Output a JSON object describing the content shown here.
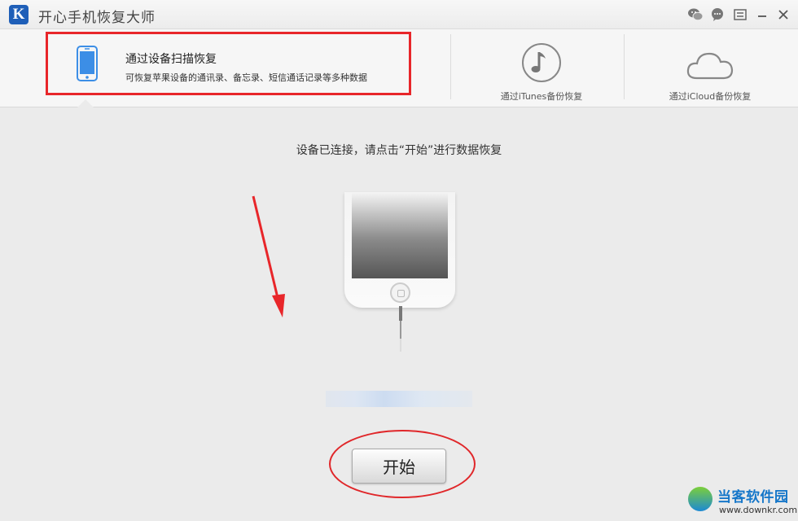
{
  "window": {
    "logo_letter": "K",
    "title": "开心手机恢复大师",
    "controls": [
      "wechat-icon",
      "chat-icon",
      "menu-icon",
      "minimize-icon",
      "close-icon"
    ]
  },
  "tabs": {
    "active": {
      "title": "通过设备扫描恢复",
      "description": "可恢复苹果设备的通讯录、备忘录、短信通话记录等多种数据",
      "icon": "phone-icon"
    },
    "itunes": {
      "label": "通过iTunes备份恢复",
      "icon": "music-note-icon"
    },
    "icloud": {
      "label": "通过iCloud备份恢复",
      "icon": "cloud-icon"
    }
  },
  "main": {
    "status": "设备已连接，请点击“开始”进行数据恢复",
    "start_label": "开始"
  },
  "colors": {
    "annotation": "#e8262a",
    "logo_blue": "#1f5fb8",
    "icon_blue": "#3c8ee6"
  },
  "watermark": {
    "name": "当客软件园",
    "url": "www.downkr.com"
  }
}
